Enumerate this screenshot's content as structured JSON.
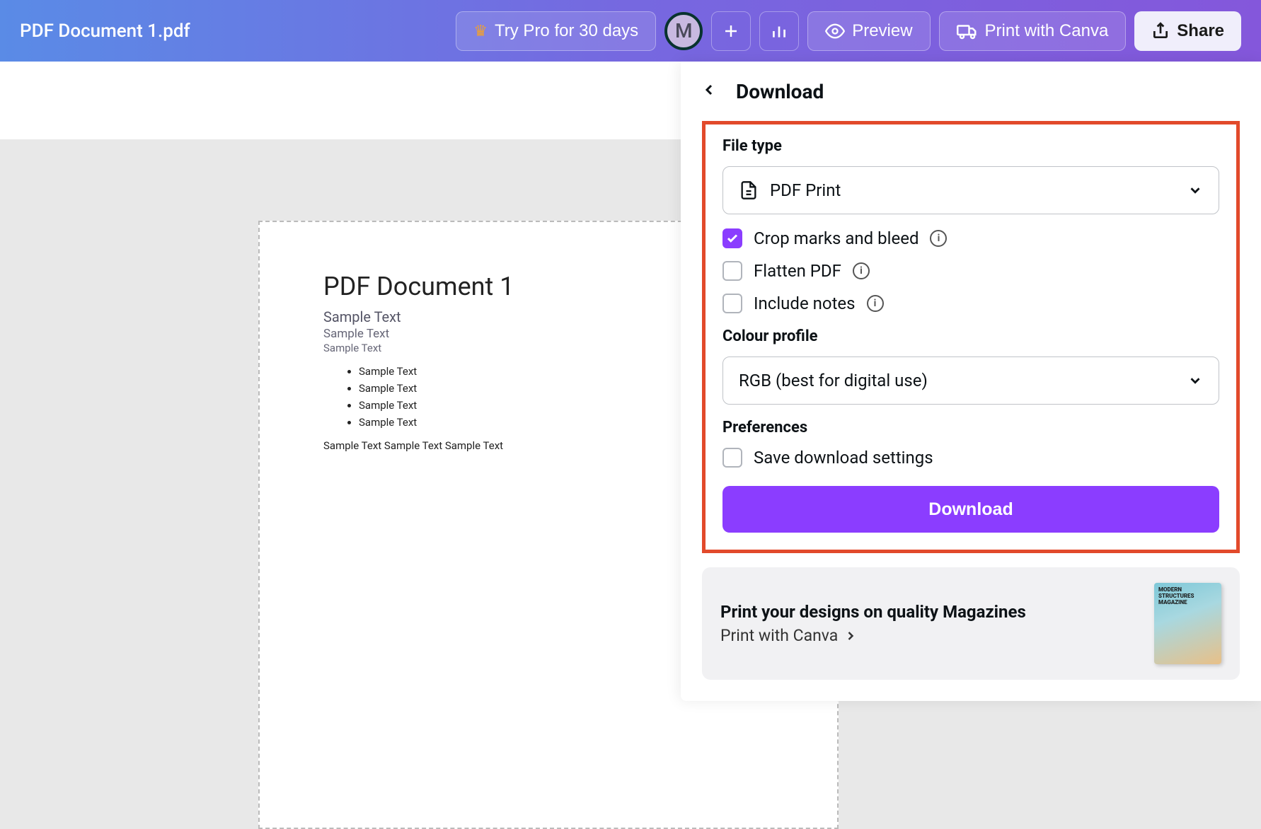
{
  "header": {
    "doc_title": "PDF Document 1.pdf",
    "try_pro": "Try Pro for 30 days",
    "avatar_letter": "M",
    "preview": "Preview",
    "print_canva": "Print with Canva",
    "share": "Share"
  },
  "canvas": {
    "title": "PDF Document 1",
    "line1": "Sample Text",
    "line2": "Sample Text",
    "line3": "Sample Text",
    "bullets": [
      "Sample  Text",
      "Sample  Text",
      "Sample  Text",
      "Sample Text"
    ],
    "bottom": "Sample Text Sample Text Sample Text"
  },
  "panel": {
    "title": "Download",
    "file_type_label": "File type",
    "file_type_value": "PDF Print",
    "crop_marks": "Crop marks and bleed",
    "flatten": "Flatten PDF",
    "include_notes": "Include notes",
    "colour_label": "Colour profile",
    "colour_value": "RGB (best for digital use)",
    "prefs_label": "Preferences",
    "save_settings": "Save download settings",
    "download_btn": "Download"
  },
  "promo": {
    "title": "Print your designs on quality Magazines",
    "link": "Print with Canva",
    "thumb_text": "MODERN STRUCTURES MAGAZINE"
  }
}
